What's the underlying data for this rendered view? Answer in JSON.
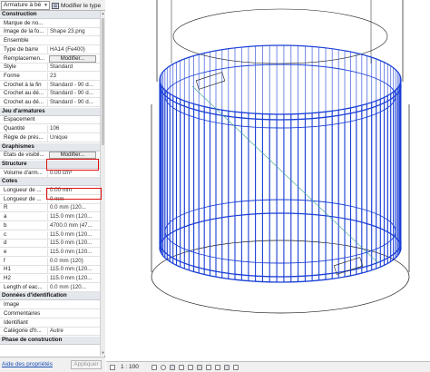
{
  "palette": {
    "type_selector": "Armature à bé",
    "edit_type": "Modifier le type",
    "rows": [
      {
        "kind": "section",
        "label": "Construction"
      },
      {
        "label": "Marque de no...",
        "value": ""
      },
      {
        "label": "Image de la fo...",
        "value": "Shape 23.png"
      },
      {
        "label": "Ensemble",
        "value": ""
      },
      {
        "label": "Type de barre",
        "value": "HA14 (Fe400)"
      },
      {
        "label": "Remplacemen...",
        "value": "Modifier...",
        "button": true
      },
      {
        "label": "Style",
        "value": "Standard"
      },
      {
        "label": "Forme",
        "value": "23"
      },
      {
        "label": "Crochet à la fin",
        "value": "Standard - 90 d..."
      },
      {
        "label": "Crochet au dé...",
        "value": "Standard - 90 d..."
      },
      {
        "label": "Crochet au dé...",
        "value": "Standard - 90 d..."
      },
      {
        "kind": "section",
        "label": "Jeu d'armatures"
      },
      {
        "label": "Espacement",
        "value": ""
      },
      {
        "label": "Quantité",
        "value": "106"
      },
      {
        "label": "Règle de prés...",
        "value": "Unique"
      },
      {
        "kind": "section",
        "label": "Graphismes"
      },
      {
        "label": "Etats de visibil...",
        "value": "Modifier...",
        "button": true
      },
      {
        "kind": "section",
        "label": "Structure"
      },
      {
        "label": "Volume d'arm...",
        "value": "0.00 cm³"
      },
      {
        "kind": "section",
        "label": "Cotes"
      },
      {
        "label": "Longueur de ...",
        "value": "0.00 mm"
      },
      {
        "label": "Longueur de ...",
        "value": "0 mm"
      },
      {
        "label": "R",
        "value": "0.0 mm (120..."
      },
      {
        "label": "a",
        "value": "115.0 mm (120..."
      },
      {
        "label": "b",
        "value": "4700.0 mm (47..."
      },
      {
        "label": "c",
        "value": "115.0 mm (120..."
      },
      {
        "label": "d",
        "value": "115.0 mm (120..."
      },
      {
        "label": "e",
        "value": "115.0 mm (120..."
      },
      {
        "label": "f",
        "value": "0.0 mm (120)"
      },
      {
        "label": "H1",
        "value": "115.0 mm (120..."
      },
      {
        "label": "H2",
        "value": "115.0 mm (120..."
      },
      {
        "label": "Length of eac...",
        "value": "0.0 mm (120..."
      },
      {
        "kind": "section",
        "label": "Données d'identification"
      },
      {
        "label": "Image",
        "value": ""
      },
      {
        "label": "Commentaires",
        "value": ""
      },
      {
        "label": "Identifiant",
        "value": ""
      },
      {
        "label": "Catégorie d'h...",
        "value": "Autre"
      },
      {
        "kind": "section",
        "label": "Phase de construction"
      }
    ],
    "help_link": "Aide des propriétés",
    "apply": "Appliquer"
  },
  "annotations": {
    "mark_1": "??",
    "mark_2": "??"
  },
  "viewbar": {
    "scale": "1 : 100",
    "icons": [
      "page-icon",
      "cube-icon",
      "sun-icon",
      "shadow-icon",
      "crop-icon",
      "crop-region-icon",
      "lock-icon",
      "hide-icon",
      "reveal-icon",
      "analysis-icon",
      "constraints-icon"
    ]
  },
  "colors": {
    "rebar": "#1a3fd6",
    "concrete_edge": "#1a1a1a",
    "hidden_line": "#3aa58a",
    "annotation": "#e01010"
  }
}
